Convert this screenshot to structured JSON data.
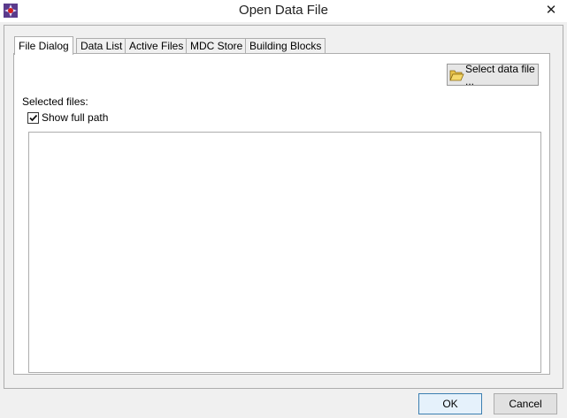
{
  "window": {
    "title": "Open Data File",
    "close_glyph": "✕",
    "app_icon": "fcs-express-icon"
  },
  "tabs": [
    {
      "label": "File Dialog",
      "active": true
    },
    {
      "label": "Data List",
      "active": false
    },
    {
      "label": "Active Files",
      "active": false
    },
    {
      "label": "MDC Store",
      "active": false
    },
    {
      "label": "Building Blocks",
      "active": false
    }
  ],
  "file_dialog": {
    "select_button_label": "Select data file ...",
    "select_button_icon": "folder-open-icon",
    "selected_files_label": "Selected files:",
    "show_full_path": {
      "label": "Show full path",
      "checked": true
    },
    "selected_files": []
  },
  "footer": {
    "ok_label": "OK",
    "cancel_label": "Cancel"
  }
}
